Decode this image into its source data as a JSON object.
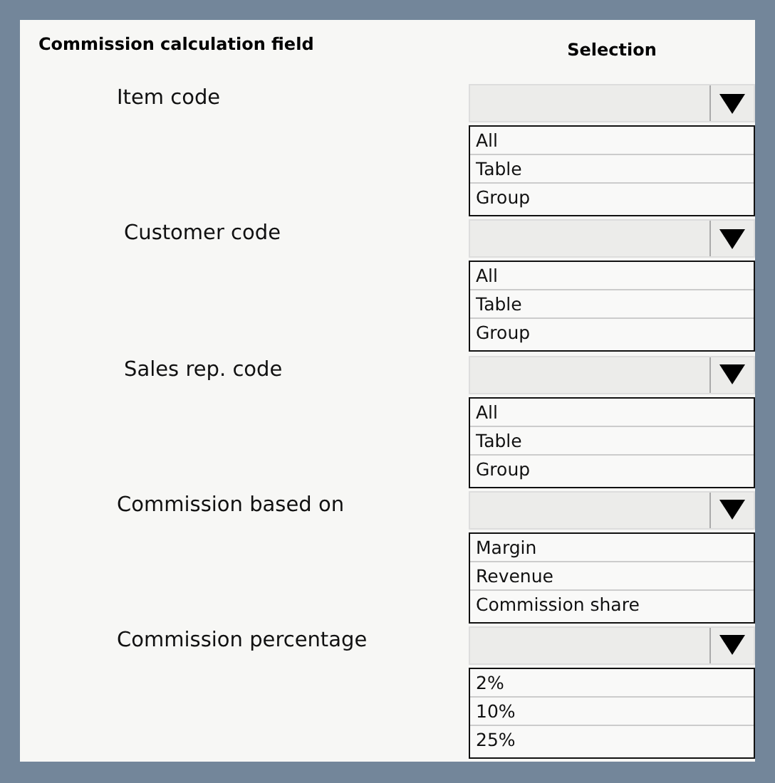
{
  "headers": {
    "field": "Commission calculation field",
    "selection": "Selection"
  },
  "fields": [
    {
      "label": "Item code",
      "options": [
        "All",
        "Table",
        "Group"
      ]
    },
    {
      "label": "Customer code",
      "options": [
        "All",
        "Table",
        "Group"
      ]
    },
    {
      "label": "Sales rep. code",
      "options": [
        "All",
        "Table",
        "Group"
      ]
    },
    {
      "label": "Commission based on",
      "options": [
        "Margin",
        "Revenue",
        "Commission share"
      ]
    },
    {
      "label": "Commission percentage",
      "options": [
        "2%",
        "10%",
        "25%"
      ]
    }
  ]
}
